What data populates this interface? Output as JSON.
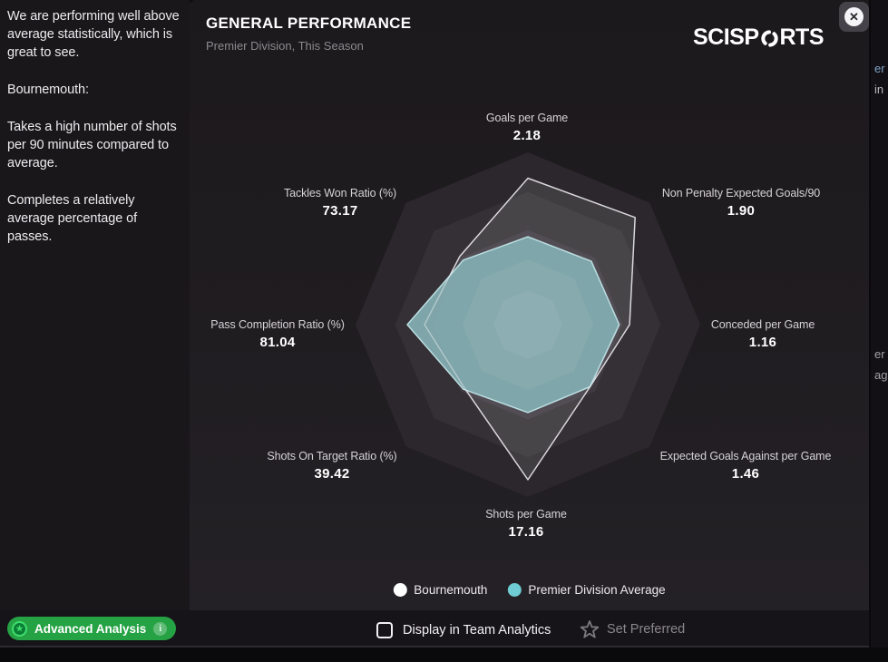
{
  "sidebar": {
    "paragraphs": [
      "We are performing well above average statistically, which is great to see.",
      "Bournemouth:",
      "Takes a high number of shots per 90 minutes compared to average.",
      "Completes a relatively average percentage of passes."
    ]
  },
  "panel": {
    "title": "GENERAL PERFORMANCE",
    "subtitle": "Premier Division, This Season",
    "brand_left": "SCISP",
    "brand_right": "RTS",
    "close_glyph": "✕"
  },
  "chart_data": {
    "type": "radar",
    "title": "General Performance — Bournemouth vs Premier Division Average",
    "axes": [
      {
        "label": "Goals per Game",
        "value": "2.18"
      },
      {
        "label": "Non Penalty Expected Goals/90",
        "value": "1.90"
      },
      {
        "label": "Conceded per Game",
        "value": "1.16"
      },
      {
        "label": "Expected Goals Against per Game",
        "value": "1.46"
      },
      {
        "label": "Shots per Game",
        "value": "17.16"
      },
      {
        "label": "Shots On Target Ratio (%)",
        "value": "39.42"
      },
      {
        "label": "Pass Completion Ratio (%)",
        "value": "81.04"
      },
      {
        "label": "Tackles Won Ratio (%)",
        "value": "73.17"
      }
    ],
    "series": [
      {
        "name": "Bournemouth",
        "color": "#ffffff",
        "r_norm": [
          0.85,
          0.88,
          0.59,
          0.51,
          0.9,
          0.52,
          0.6,
          0.56
        ],
        "fill": "rgba(255,255,255,0.10)",
        "stroke": "rgba(242,240,244,0.75)"
      },
      {
        "name": "Premier Division Average",
        "color": "#6fccd3",
        "r_norm": [
          0.51,
          0.52,
          0.53,
          0.51,
          0.51,
          0.53,
          0.7,
          0.53
        ],
        "fill": "rgba(129,170,174,0.96)",
        "stroke": "rgba(193,228,231,0.95)"
      }
    ],
    "rings": {
      "fractions": [
        1.0,
        0.77,
        0.55,
        0.38,
        0.2
      ],
      "colors": [
        "#2b272c",
        "#343035",
        "#3f3942",
        "#474049",
        "#4d4650"
      ],
      "highlight_fractions": [
        0.38,
        0.2
      ]
    },
    "max_radius": 190,
    "center": {
      "x": 373,
      "y": 358
    },
    "legend_position": "bottom"
  },
  "legend": {
    "items": [
      {
        "label": "Bournemouth",
        "color": "#ffffff"
      },
      {
        "label": "Premier Division Average",
        "color": "#6fccd3"
      }
    ]
  },
  "footer": {
    "checkbox_label": "Display in Team Analytics",
    "checkbox_checked": false,
    "set_preferred_label": "Set Preferred",
    "advanced_analysis_label": "Advanced Analysis",
    "advanced_analysis_color": "#25a244"
  },
  "right_edge_fragments": [
    {
      "text": "er",
      "y": 68,
      "color": "#7fa3c6"
    },
    {
      "text": "in",
      "y": 91,
      "color": "#bab7bb"
    },
    {
      "text": "er",
      "y": 383,
      "color": "#a5a2a6"
    },
    {
      "text": "ag",
      "y": 406,
      "color": "#a5a2a6"
    }
  ]
}
